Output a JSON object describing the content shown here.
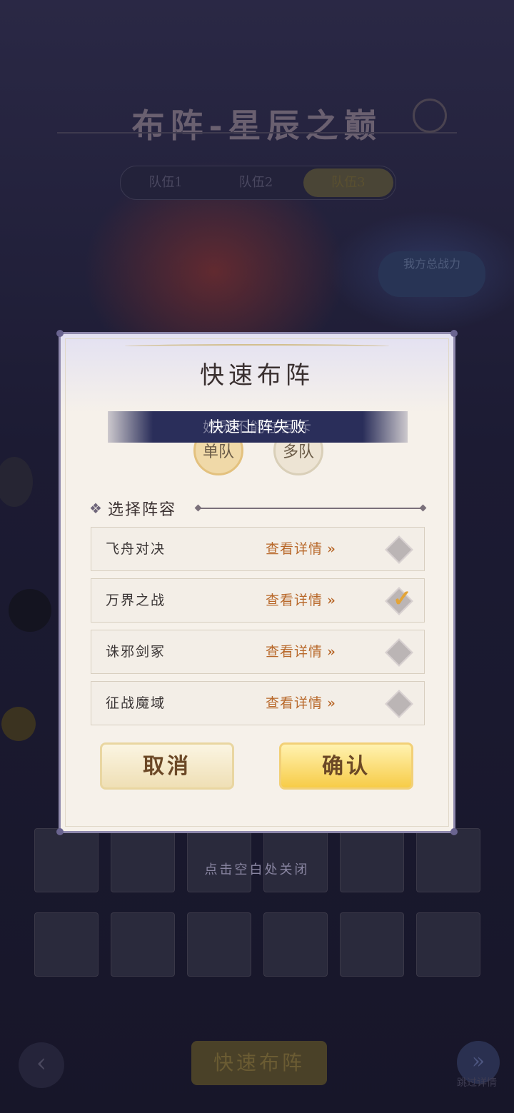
{
  "background": {
    "title": "布阵-星辰之巅",
    "tabs": [
      "队伍1",
      "队伍2",
      "队伍3"
    ],
    "power_text": "我方总战力",
    "close_hint": "点击空白处关闭",
    "quick_button": "快速布阵",
    "forward_label": "跳过详情"
  },
  "dialog": {
    "title": "快速布阵",
    "modes": {
      "single": "单队",
      "multi": "多队"
    },
    "mode_description": "妖灵不能在互斥",
    "toast": "快速上阵失败",
    "section_title": "选择阵容",
    "detail_label": "查看详情",
    "detail_arrow": "»",
    "lineups": [
      {
        "name": "飞舟对决",
        "checked": false
      },
      {
        "name": "万界之战",
        "checked": true
      },
      {
        "name": "诛邪剑冢",
        "checked": false
      },
      {
        "name": "征战魔域",
        "checked": false
      }
    ],
    "cancel_label": "取消",
    "confirm_label": "确认"
  }
}
